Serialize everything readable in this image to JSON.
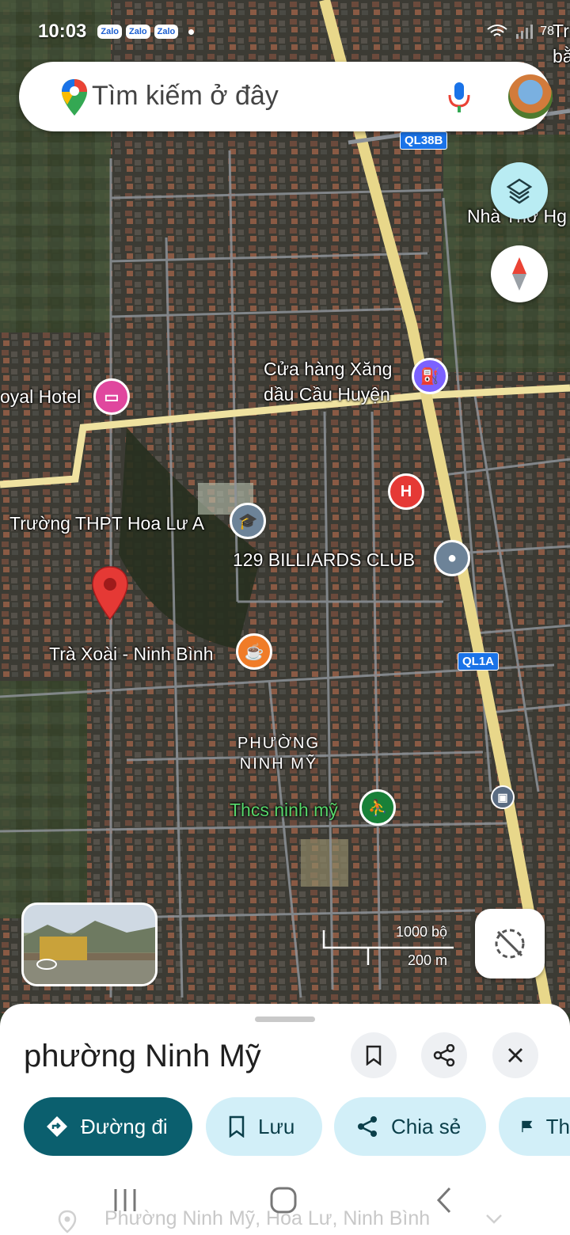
{
  "status_bar": {
    "time": "10:03",
    "apps": [
      "Zalo",
      "Zalo",
      "Zalo"
    ],
    "battery": "78"
  },
  "search": {
    "placeholder": "Tìm kiếm ở đây"
  },
  "map": {
    "labels": {
      "nha_tho": "Nhà Thờ Hg",
      "gas_station": "Cửa hàng Xăng\ndầu Cầu Huyện",
      "hotel": "oyal Hotel",
      "school": "Trường THPT Hoa Lư A",
      "billiards": "129 BILLIARDS CLUB",
      "tra_xoai": "Trà Xoài - Ninh Bình",
      "ward": "PHƯỜNG\nNINH MỸ",
      "thcs": "Thcs ninh mỹ",
      "corner_a": "Tr",
      "corner_b": "bằ"
    },
    "road_shields": {
      "ql38b": "QL38B",
      "ql1a": "QL1A"
    },
    "scale": {
      "imperial": "1000 bộ",
      "metric": "200 m"
    },
    "poi_h": "H"
  },
  "sheet": {
    "title": "phường Ninh Mỹ",
    "chips": {
      "directions": "Đường đi",
      "save": "Lưu",
      "share": "Chia sẻ",
      "more": "Th"
    },
    "ghost_address": "Phường Ninh Mỹ, Hoa Lư, Ninh Bình"
  },
  "colors": {
    "primary": "#0b5f6e",
    "chip_bg": "#d2eff8",
    "highway": "#e8d78a",
    "pin_red": "#e53935"
  }
}
